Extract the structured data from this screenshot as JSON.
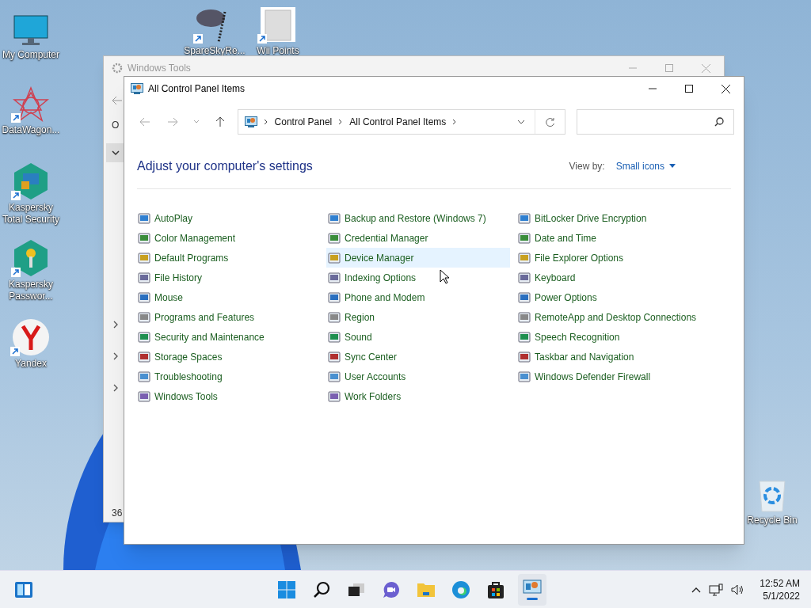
{
  "desktop_icons": [
    {
      "label": "My Computer",
      "kind": "monitor"
    },
    {
      "label": "DataWagon...",
      "kind": "star",
      "shortcut": true
    },
    {
      "label": "Kaspersky Total Security",
      "kind": "kaspersky",
      "shortcut": true
    },
    {
      "label": "Kaspersky Passwor...",
      "kind": "key",
      "shortcut": true
    },
    {
      "label": "Yandex",
      "kind": "yandex",
      "shortcut": true
    },
    {
      "label": "SpareSkyRe...",
      "kind": "sky",
      "shortcut": true
    },
    {
      "label": "Wii Points",
      "kind": "wii",
      "shortcut": true
    },
    {
      "label": "Recycle Bin",
      "kind": "recycle"
    }
  ],
  "back_window": {
    "title": "Windows Tools",
    "letter": "O",
    "count": "36"
  },
  "window": {
    "title": "All Control Panel Items",
    "breadcrumb": [
      "Control Panel",
      "All Control Panel Items"
    ],
    "heading": "Adjust your computer's settings",
    "view_by_label": "View by:",
    "view_by_value": "Small icons",
    "columns": [
      [
        {
          "label": "AutoPlay",
          "hovered": false
        },
        {
          "label": "Color Management",
          "hovered": false
        },
        {
          "label": "Default Programs",
          "hovered": false
        },
        {
          "label": "File History",
          "hovered": false
        },
        {
          "label": "Mouse",
          "hovered": false
        },
        {
          "label": "Programs and Features",
          "hovered": false
        },
        {
          "label": "Security and Maintenance",
          "hovered": false
        },
        {
          "label": "Storage Spaces",
          "hovered": false
        },
        {
          "label": "Troubleshooting",
          "hovered": false
        },
        {
          "label": "Windows Tools",
          "hovered": false
        }
      ],
      [
        {
          "label": "Backup and Restore (Windows 7)",
          "hovered": false
        },
        {
          "label": "Credential Manager",
          "hovered": false
        },
        {
          "label": "Device Manager",
          "hovered": true
        },
        {
          "label": "Indexing Options",
          "hovered": false
        },
        {
          "label": "Phone and Modem",
          "hovered": false
        },
        {
          "label": "Region",
          "hovered": false
        },
        {
          "label": "Sound",
          "hovered": false
        },
        {
          "label": "Sync Center",
          "hovered": false
        },
        {
          "label": "User Accounts",
          "hovered": false
        },
        {
          "label": "Work Folders",
          "hovered": false
        }
      ],
      [
        {
          "label": "BitLocker Drive Encryption",
          "hovered": false
        },
        {
          "label": "Date and Time",
          "hovered": false
        },
        {
          "label": "File Explorer Options",
          "hovered": false
        },
        {
          "label": "Keyboard",
          "hovered": false
        },
        {
          "label": "Power Options",
          "hovered": false
        },
        {
          "label": "RemoteApp and Desktop Connections",
          "hovered": false
        },
        {
          "label": "Speech Recognition",
          "hovered": false
        },
        {
          "label": "Taskbar and Navigation",
          "hovered": false
        },
        {
          "label": "Windows Defender Firewall",
          "hovered": false
        }
      ]
    ]
  },
  "taskbar": {
    "time": "12:52 AM",
    "date": "5/1/2022"
  }
}
